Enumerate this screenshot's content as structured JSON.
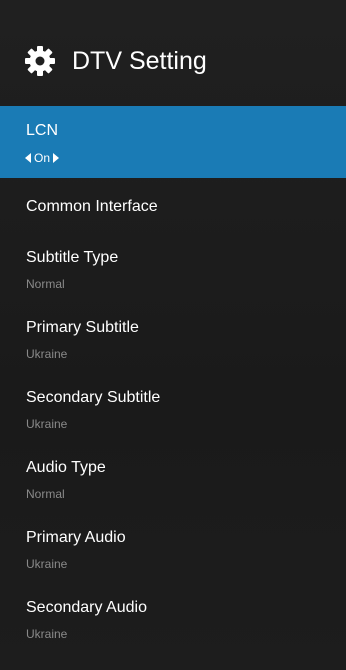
{
  "header": {
    "icon": "gear-icon",
    "title": "DTV Setting"
  },
  "colors": {
    "accent": "#1a7bb5",
    "background": "#1c1c1c",
    "value_text": "#8a8a8a"
  },
  "menu": {
    "selected": {
      "label": "LCN",
      "value": "On"
    },
    "common_interface": {
      "label": "Common Interface"
    },
    "subtitle_type": {
      "label": "Subtitle Type",
      "value": "Normal"
    },
    "primary_subtitle": {
      "label": "Primary Subtitle",
      "value": "Ukraine"
    },
    "secondary_subtitle": {
      "label": "Secondary Subtitle",
      "value": "Ukraine"
    },
    "audio_type": {
      "label": "Audio Type",
      "value": "Normal"
    },
    "primary_audio": {
      "label": "Primary Audio",
      "value": "Ukraine"
    },
    "secondary_audio": {
      "label": "Secondary Audio",
      "value": "Ukraine"
    }
  }
}
